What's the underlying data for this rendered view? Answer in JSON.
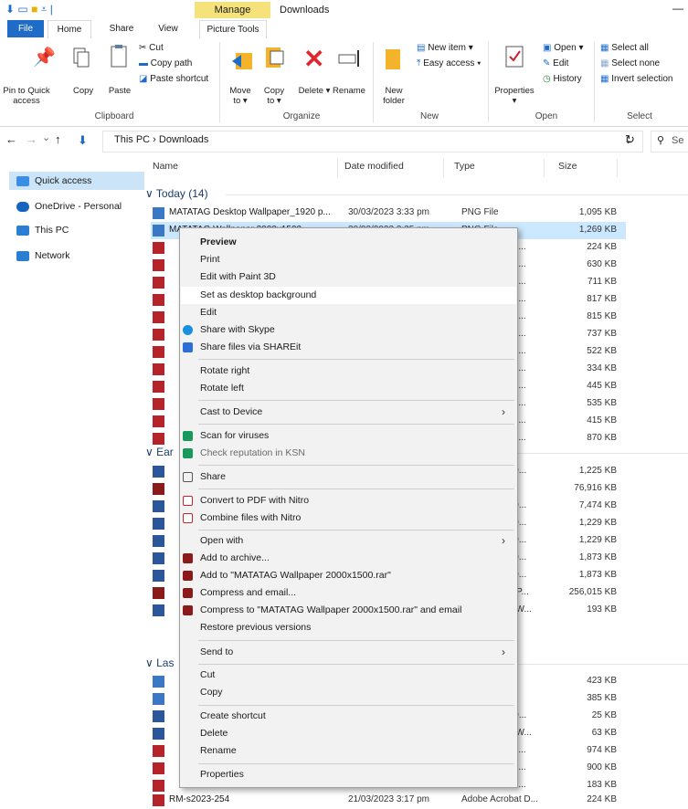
{
  "title_bar": {
    "manage_tab": "Manage",
    "window_title": "Downloads"
  },
  "tabs": {
    "file": "File",
    "home": "Home",
    "share": "Share",
    "view": "View",
    "picture_tools": "Picture Tools"
  },
  "ribbon": {
    "pin_label": "Pin to Quick access",
    "copy_label": "Copy",
    "paste_label": "Paste",
    "cut_label": "Cut",
    "copy_path_label": "Copy path",
    "paste_shortcut_label": "Paste shortcut",
    "clipboard_group": "Clipboard",
    "move_to_label": "Move to ▾",
    "copy_to_label": "Copy to ▾",
    "delete_label": "Delete ▾",
    "rename_label": "Rename",
    "organize_group": "Organize",
    "new_folder_label": "New folder",
    "new_item_label": "New item ▾",
    "easy_access_label": "Easy access ▾",
    "new_group": "New",
    "properties_label": "Properties",
    "properties_sub": "▾",
    "open_label": "Open ▾",
    "edit_label": "Edit",
    "history_label": "History",
    "open_group": "Open",
    "select_all_label": "Select all",
    "select_none_label": "Select none",
    "invert_selection_label": "Invert selection",
    "select_group": "Select"
  },
  "nav": {
    "back": "←",
    "forward": "→",
    "recent": "⌄",
    "up": "↑",
    "address": "This PC  ›  Downloads",
    "dropdown": "⌄",
    "refresh": "↻",
    "search_placeholder": "Se"
  },
  "sidebar": {
    "items": [
      {
        "label": "Quick access",
        "color": "#3a8ee6"
      },
      {
        "label": "OneDrive - Personal",
        "color": "#1565c0"
      },
      {
        "label": "This PC",
        "color": "#2a7fd4"
      },
      {
        "label": "Network",
        "color": "#2a7fd4"
      }
    ]
  },
  "columns": {
    "name": "Name",
    "date": "Date modified",
    "type": "Type",
    "size": "Size"
  },
  "groups": {
    "today": "Today (14)",
    "earlier": "Ear",
    "last": "Las"
  },
  "rows": {
    "r1": {
      "name": "MATATAG Desktop Wallpaper_1920 p...",
      "date": "30/03/2023 3:33 pm",
      "type": "PNG File",
      "size": "1,095 KB"
    },
    "r2": {
      "name": "MATATAG Wallpaper 2000x1500",
      "date": "30/03/2023 3:35 pm",
      "type": "PNG File",
      "size": "1,269 KB"
    },
    "today_sizes": [
      "224 KB",
      "630 KB",
      "711 KB",
      "817 KB",
      "815 KB",
      "737 KB",
      "522 KB",
      "334 KB",
      "445 KB",
      "535 KB",
      "415 KB",
      "870 KB"
    ],
    "today_types": [
      "at D...",
      "at D...",
      "at D...",
      "at D...",
      "at D...",
      "at D...",
      "at D...",
      "at D...",
      "at D...",
      "at D...",
      "at D...",
      "at D..."
    ],
    "earlier": [
      {
        "type": "rd D...",
        "size": "1,225 KB"
      },
      {
        "type": "ive",
        "size": "76,916 KB"
      },
      {
        "type": "rd D...",
        "size": "7,474 KB"
      },
      {
        "type": "rd D...",
        "size": "1,229 KB"
      },
      {
        "type": "rd D...",
        "size": "1,229 KB"
      },
      {
        "type": "rd D...",
        "size": "1,873 KB"
      },
      {
        "type": "rd D...",
        "size": "1,873 KB"
      },
      {
        "type": "werP...",
        "size": "256,015 KB"
      },
      {
        "type": "cel W...",
        "size": "193 KB"
      }
    ],
    "last": [
      {
        "type": "",
        "size": "423 KB"
      },
      {
        "type": "",
        "size": "385 KB"
      },
      {
        "type": "rd D...",
        "size": "25 KB"
      },
      {
        "type": "cel W...",
        "size": "63 KB"
      },
      {
        "type": "at D...",
        "size": "974 KB"
      },
      {
        "type": "at D...",
        "size": "900 KB"
      },
      {
        "type": "at D...",
        "size": "183 KB"
      }
    ],
    "bottom": {
      "name": "RM-s2023-254",
      "date": "21/03/2023 3:17 pm",
      "type": "Adobe Acrobat D...",
      "size": "224 KB"
    }
  },
  "context_menu": {
    "preview": "Preview",
    "print": "Print",
    "edit_paint3d": "Edit with Paint 3D",
    "set_desktop": "Set as desktop background",
    "edit": "Edit",
    "share_skype": "Share with Skype",
    "share_shareit": "Share files via SHAREit",
    "rotate_right": "Rotate right",
    "rotate_left": "Rotate left",
    "cast": "Cast to Device",
    "scan": "Scan for viruses",
    "check_rep": "Check reputation in KSN",
    "share": "Share",
    "convert_nitro": "Convert to PDF with Nitro",
    "combine_nitro": "Combine files with Nitro",
    "open_with": "Open with",
    "add_archive": "Add to archive...",
    "add_rar": "Add to \"MATATAG Wallpaper 2000x1500.rar\"",
    "compress_email": "Compress and email...",
    "compress_rar_email": "Compress to \"MATATAG Wallpaper 2000x1500.rar\" and email",
    "restore": "Restore previous versions",
    "send_to": "Send to",
    "cut": "Cut",
    "copy": "Copy",
    "create_shortcut": "Create shortcut",
    "delete": "Delete",
    "rename": "Rename",
    "properties": "Properties",
    "submenu_arrow": "›"
  }
}
